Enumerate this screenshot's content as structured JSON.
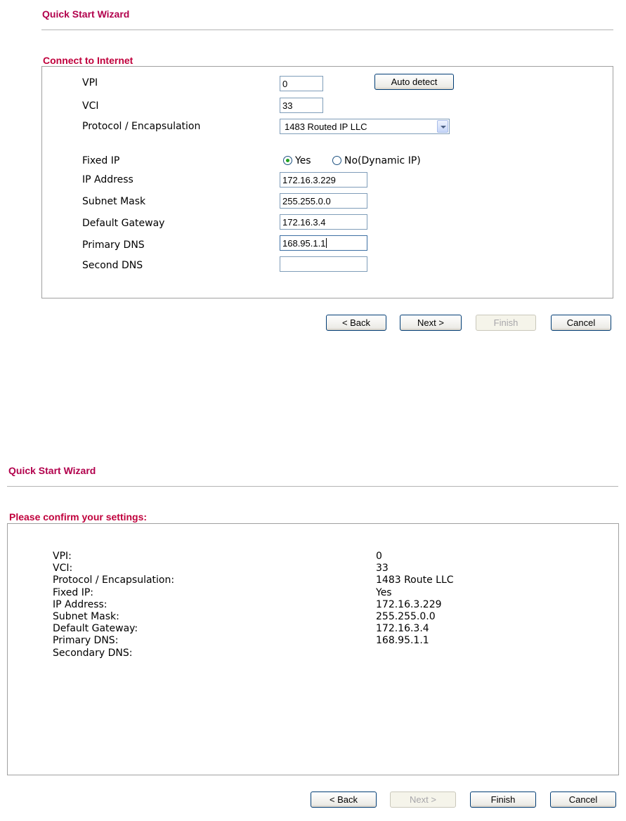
{
  "screen1": {
    "wizard_title": "Quick Start Wizard",
    "section_title": "Connect to Internet",
    "vpi": {
      "label": "VPI",
      "value": "0"
    },
    "vci": {
      "label": "VCI",
      "value": "33"
    },
    "auto_detect_label": "Auto detect",
    "protocol": {
      "label": "Protocol / Encapsulation",
      "value": "1483 Routed IP LLC"
    },
    "fixed_ip": {
      "label": "Fixed IP",
      "yes_label": "Yes",
      "no_label": "No(Dynamic IP)",
      "selected": "Yes"
    },
    "ip_address": {
      "label": "IP Address",
      "value": "172.16.3.229"
    },
    "subnet_mask": {
      "label": "Subnet Mask",
      "value": "255.255.0.0"
    },
    "default_gateway": {
      "label": "Default Gateway",
      "value": "172.16.3.4"
    },
    "primary_dns": {
      "label": "Primary DNS",
      "value": "168.95.1.1"
    },
    "second_dns": {
      "label": "Second DNS",
      "value": ""
    },
    "buttons": {
      "back": "< Back",
      "next": "Next >",
      "finish": "Finish",
      "cancel": "Cancel"
    }
  },
  "screen2": {
    "wizard_title": "Quick Start Wizard",
    "section_title": "Please confirm your settings:",
    "rows": [
      {
        "label": "VPI:",
        "value": "0"
      },
      {
        "label": "VCI:",
        "value": "33"
      },
      {
        "label": "Protocol / Encapsulation:",
        "value": "1483 Route LLC"
      },
      {
        "label": "Fixed IP:",
        "value": "Yes"
      },
      {
        "label": "IP Address:",
        "value": "172.16.3.229"
      },
      {
        "label": "Subnet Mask:",
        "value": "255.255.0.0"
      },
      {
        "label": "Default Gateway:",
        "value": "172.16.3.4"
      },
      {
        "label": "Primary DNS:",
        "value": "168.95.1.1"
      },
      {
        "label": "Secondary DNS:",
        "value": ""
      }
    ],
    "buttons": {
      "back": "< Back",
      "next": "Next >",
      "finish": "Finish",
      "cancel": "Cancel"
    }
  },
  "colors": {
    "title": "#b2004c",
    "section_title": "#c0003c",
    "border": "#a0a0a0"
  }
}
